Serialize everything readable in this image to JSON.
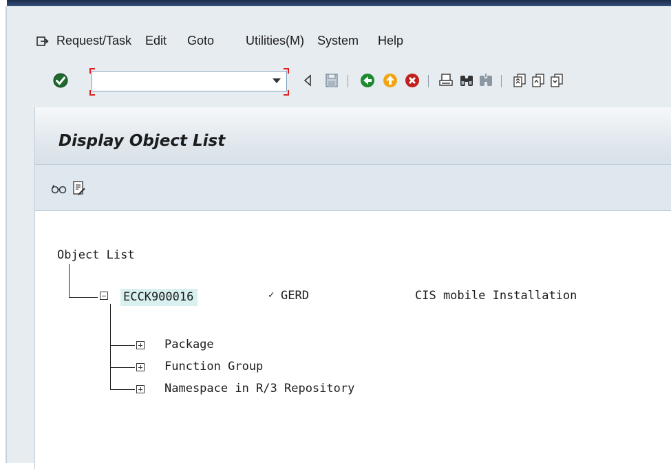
{
  "menubar": {
    "icon": "exit-menu-icon",
    "items": [
      "Request/Task",
      "Edit",
      "Goto",
      "Utilities(M)",
      "System",
      "Help"
    ]
  },
  "toolbar": {
    "command_value": "",
    "icons": [
      "enter-check-icon",
      "back-arrow-icon",
      "save-icon",
      "back-icon",
      "exit-icon",
      "cancel-icon",
      "print-icon",
      "find-icon",
      "find-next-icon",
      "first-page-icon",
      "previous-page-icon",
      "next-page-icon"
    ]
  },
  "page": {
    "title": "Display Object List",
    "toolbar_icons": [
      "display-glasses-icon",
      "document-edit-icon"
    ]
  },
  "tree": {
    "root_label": "Object List",
    "request": {
      "id": "ECCK900016",
      "status_mark": "✓",
      "owner": "GERD",
      "description": "CIS mobile Installation"
    },
    "children": [
      "Package",
      "Function Group",
      "Namespace in R/3 Repository"
    ]
  },
  "colors": {
    "title_bar_from": "#f6f8fa",
    "title_bar_to": "#d8e1e8",
    "app_toolbar": "#dfe8ef",
    "window_bg": "#e7ecf0",
    "selection_highlight": "#d8f0f0",
    "focus_corner": "#e02020"
  }
}
